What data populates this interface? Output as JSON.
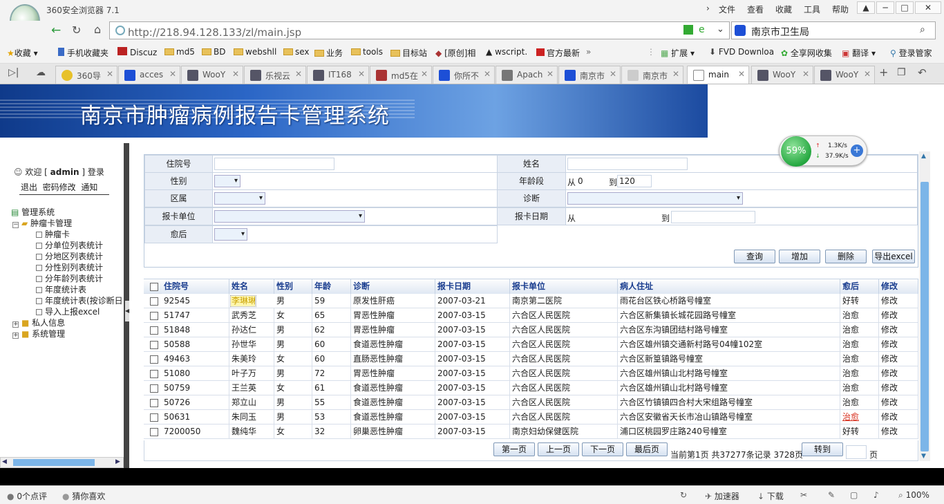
{
  "browser": {
    "title": "360安全浏览器 7.1",
    "menu": [
      "文件",
      "查看",
      "收藏",
      "工具",
      "帮助"
    ],
    "url": "http://218.94.128.133/zl/main.jsp",
    "search_text": "南京市卫生局",
    "bookmarks": [
      "收藏",
      "手机收藏夹",
      "Discuz",
      "md5",
      "BD",
      "webshll",
      "sex",
      "业务",
      "tools",
      "目标站",
      "[原创]相",
      "wscript.",
      "官方最新"
    ],
    "bookmark_right": [
      "扩展",
      "FVD Downloa",
      "全享网收集",
      "翻译",
      "登录管家"
    ],
    "tabs": [
      "360导",
      "acces",
      "WooY",
      "乐视云",
      "IT168",
      "md5在",
      "你所不",
      "Apach",
      "南京市",
      "南京市",
      "main",
      "WooY",
      "WooY"
    ],
    "active_tab_index": 10
  },
  "banner": {
    "title": "南京市肿瘤病例报告卡管理系统"
  },
  "left": {
    "welcome_prefix": "欢迎 [",
    "user": "admin",
    "welcome_suffix": "] 登录",
    "links": [
      "退出",
      "密码修改",
      "通知"
    ],
    "tree": {
      "root": "管理系统",
      "group1": "肿瘤卡管理",
      "items": [
        "肿瘤卡",
        "分单位列表统计",
        "分地区列表统计",
        "分性别列表统计",
        "分年龄列表统计",
        "年度统计表",
        "年度统计表(按诊断日",
        "导入上报excel"
      ],
      "group2": "私人信息",
      "group3": "系统管理"
    }
  },
  "form": {
    "labels": {
      "hospital_no": "住院号",
      "name": "姓名",
      "gender": "性别",
      "age_range": "年龄段",
      "district": "区属",
      "diagnosis": "诊断",
      "report_unit": "报卡单位",
      "report_date": "报卡日期",
      "outcome": "愈后"
    },
    "age_from_prefix": "从",
    "age_from": "0",
    "age_to_prefix": "到",
    "age_to": "120",
    "date_from_prefix": "从",
    "date_to_prefix": "到",
    "buttons": [
      "查询",
      "增加",
      "删除",
      "导出excel"
    ]
  },
  "table": {
    "headers": [
      "住院号",
      "姓名",
      "性别",
      "年龄",
      "诊断",
      "报卡日期",
      "报卡单位",
      "病人住址",
      "愈后",
      "修改"
    ],
    "rows": [
      [
        "92545",
        "李琳琳",
        "男",
        "59",
        "原发性肝癌",
        "2007-03-21",
        "南京第二医院",
        "雨花台区铁心桥路号幢室",
        "好转",
        "修改"
      ],
      [
        "51747",
        "武秀芝",
        "女",
        "65",
        "胃恶性肿瘤",
        "2007-03-15",
        "六合区人民医院",
        "六合区新集镇长城花园路号幢室",
        "治愈",
        "修改"
      ],
      [
        "51848",
        "孙达仁",
        "男",
        "62",
        "胃恶性肿瘤",
        "2007-03-15",
        "六合区人民医院",
        "六合区东沟镇团结村路号幢室",
        "治愈",
        "修改"
      ],
      [
        "50588",
        "孙世华",
        "男",
        "60",
        "食道恶性肿瘤",
        "2007-03-15",
        "六合区人民医院",
        "六合区雄州镇交通新村路号04幢102室",
        "治愈",
        "修改"
      ],
      [
        "49463",
        "朱美玲",
        "女",
        "60",
        "直肠恶性肿瘤",
        "2007-03-15",
        "六合区人民医院",
        "六合区新篁镇路号幢室",
        "治愈",
        "修改"
      ],
      [
        "51080",
        "叶子万",
        "男",
        "72",
        "胃恶性肿瘤",
        "2007-03-15",
        "六合区人民医院",
        "六合区雄州镇山北村路号幢室",
        "治愈",
        "修改"
      ],
      [
        "50759",
        "王兰英",
        "女",
        "61",
        "食道恶性肿瘤",
        "2007-03-15",
        "六合区人民医院",
        "六合区雄州镇山北村路号幢室",
        "治愈",
        "修改"
      ],
      [
        "50726",
        "郑立山",
        "男",
        "55",
        "食道恶性肿瘤",
        "2007-03-15",
        "六合区人民医院",
        "六合区竹镇镇四合村大宋组路号幢室",
        "治愈",
        "修改"
      ],
      [
        "50631",
        "朱同玉",
        "男",
        "53",
        "食道恶性肿瘤",
        "2007-03-15",
        "六合区人民医院",
        "六合区安徽省天长市冶山镇路号幢室",
        "治愈",
        "修改"
      ],
      [
        "7200050",
        "魏纯华",
        "女",
        "32",
        "卵巢恶性肿瘤",
        "2007-03-15",
        "南京妇幼保健医院",
        "浦口区桃园罗庄路240号幢室",
        "好转",
        "修改"
      ]
    ]
  },
  "pager": {
    "first": "第一页",
    "prev": "上一页",
    "next": "下一页",
    "last": "最后页",
    "info": "当前第1页 共37277条记录 3728页",
    "goto": "转到",
    "page_suffix": "页"
  },
  "speed_widget": {
    "percent": "59%",
    "up": "1.3K/s",
    "down": "37.9K/s"
  },
  "status": {
    "left": [
      "0个点评",
      "猜你喜欢"
    ],
    "right": [
      "加速器",
      "下载",
      "100%"
    ]
  },
  "colors": {
    "accent": "#1a3d8f",
    "link_red": "#d7301f",
    "banner": "#2b66c6"
  }
}
